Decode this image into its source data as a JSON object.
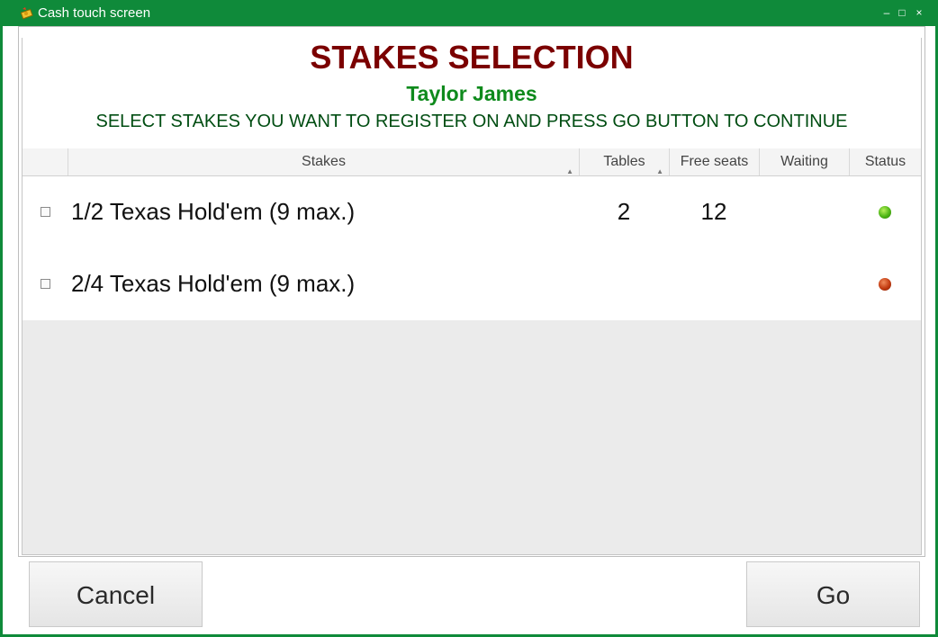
{
  "window": {
    "title": "Cash touch screen",
    "controls": {
      "minimize": "–",
      "maximize": "□",
      "close": "×"
    },
    "accent_color": "#0f8a3a"
  },
  "header": {
    "title": "STAKES SELECTION",
    "player_name": "Taylor James",
    "instruction": "SELECT STAKES YOU WANT TO REGISTER ON AND PRESS GO BUTTON TO CONTINUE"
  },
  "table": {
    "columns": {
      "stakes": "Stakes",
      "tables": "Tables",
      "free_seats": "Free seats",
      "waiting": "Waiting",
      "status": "Status"
    },
    "rows": [
      {
        "checked": false,
        "stakes": "1/2 Texas Hold'em (9 max.)",
        "tables": "2",
        "free_seats": "12",
        "waiting": "",
        "status": "green"
      },
      {
        "checked": false,
        "stakes": "2/4 Texas Hold'em (9 max.)",
        "tables": "",
        "free_seats": "",
        "waiting": "",
        "status": "red"
      }
    ]
  },
  "footer": {
    "cancel_label": "Cancel",
    "go_label": "Go"
  }
}
